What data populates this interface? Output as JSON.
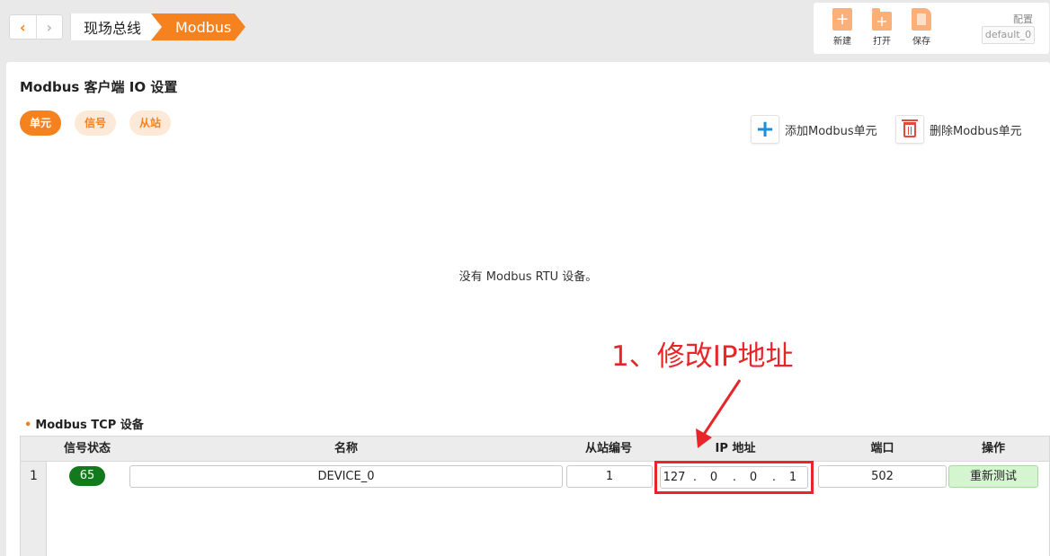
{
  "nav": {
    "back_icon": "‹",
    "forward_icon": "›"
  },
  "breadcrumb": {
    "items": [
      "现场总线",
      "Modbus"
    ]
  },
  "toolbar": {
    "new_label": "新建",
    "open_label": "打开",
    "save_label": "保存",
    "config_label": "配置",
    "config_value": "default_0"
  },
  "page": {
    "title": "Modbus 客户端 IO 设置"
  },
  "tabs": [
    {
      "label": "单元"
    },
    {
      "label": "信号"
    },
    {
      "label": "从站"
    }
  ],
  "actions": {
    "add_label": "添加Modbus单元",
    "delete_label": "删除Modbus单元"
  },
  "empty_message": "没有 Modbus RTU 设备。",
  "annotation": "1、修改IP地址",
  "tcp_section": {
    "title": "Modbus TCP 设备",
    "columns": [
      "信号状态",
      "名称",
      "从站编号",
      "IP 地址",
      "端口",
      "操作"
    ],
    "rows": [
      {
        "index": "1",
        "status": "65",
        "name": "DEVICE_0",
        "slave_id": "1",
        "ip": [
          "127",
          "0",
          "0",
          "1"
        ],
        "port": "502",
        "action_label": "重新测试"
      }
    ]
  },
  "colors": {
    "accent": "#f5821f",
    "annotation_red": "#e8262a",
    "status_green": "#127a1c"
  }
}
